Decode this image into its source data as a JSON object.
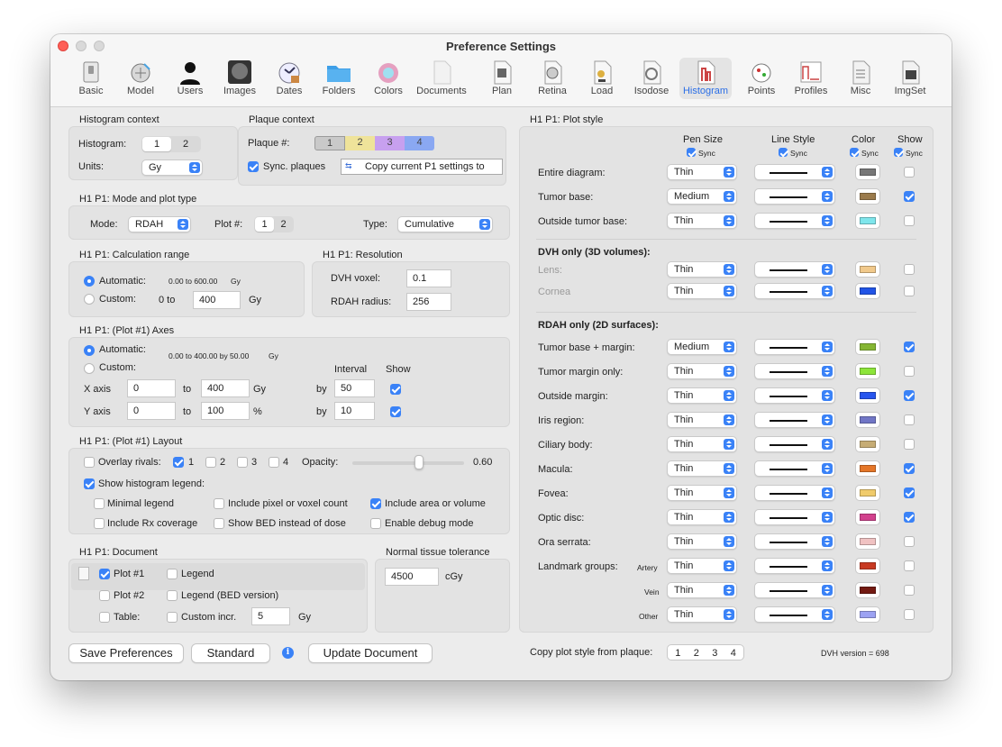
{
  "window": {
    "title": "Preference Settings"
  },
  "toolbar": [
    {
      "label": "Basic"
    },
    {
      "label": "Model"
    },
    {
      "label": "Users"
    },
    {
      "label": "Images"
    },
    {
      "label": "Dates"
    },
    {
      "label": "Folders"
    },
    {
      "label": "Colors"
    },
    {
      "label": "Documents"
    },
    {
      "label": "Plan"
    },
    {
      "label": "Retina"
    },
    {
      "label": "Load"
    },
    {
      "label": "Isodose"
    },
    {
      "label": "Histogram"
    },
    {
      "label": "Points"
    },
    {
      "label": "Profiles"
    },
    {
      "label": "Misc"
    },
    {
      "label": "ImgSet"
    }
  ],
  "histctx": {
    "title": "Histogram context",
    "hist_label": "Histogram:",
    "seg": [
      "1",
      "2"
    ],
    "units_label": "Units:",
    "units_value": "Gy"
  },
  "plaquectx": {
    "title": "Plaque context",
    "label": "Plaque #:",
    "plaques": [
      "1",
      "2",
      "3",
      "4"
    ],
    "sync_label": "Sync. plaques",
    "copy_label": "Copy current P1 settings to"
  },
  "mode": {
    "title": "H1 P1: Mode and plot type",
    "mode_label": "Mode:",
    "mode_value": "RDAH",
    "plot_label": "Plot #:",
    "plot_seg": [
      "1",
      "2"
    ],
    "type_label": "Type:",
    "type_value": "Cumulative"
  },
  "calc": {
    "title": "H1 P1: Calculation range",
    "auto_label": "Automatic:",
    "auto_range": "0.00 to 600.00",
    "auto_unit": "Gy",
    "custom_label": "Custom:",
    "from_text": "0 to",
    "to_value": "400",
    "unit": "Gy"
  },
  "resolution": {
    "title": "H1 P1: Resolution",
    "voxel_label": "DVH voxel:",
    "voxel_value": "0.1",
    "radius_label": "RDAH radius:",
    "radius_value": "256"
  },
  "axes": {
    "title": "H1 P1: (Plot #1) Axes",
    "auto_label": "Automatic:",
    "auto_range": "0.00 to 400.00 by 50.00",
    "auto_unit": "Gy",
    "custom_label": "Custom:",
    "interval_header": "Interval",
    "show_header": "Show",
    "x": {
      "label": "X axis",
      "from": "0",
      "to_text": "to",
      "to": "400",
      "unit": "Gy",
      "by": "by",
      "interval": "50"
    },
    "y": {
      "label": "Y axis",
      "from": "0",
      "to_text": "to",
      "to": "100",
      "unit": "%",
      "by": "by",
      "interval": "10"
    }
  },
  "layout": {
    "title": "H1 P1: (Plot #1) Layout",
    "overlay_label": "Overlay rivals:",
    "rivals": [
      "1",
      "2",
      "3",
      "4"
    ],
    "opacity_label": "Opacity:",
    "opacity_value": "0.60",
    "opacity_fraction": 0.6,
    "show_legend_label": "Show histogram legend:",
    "options": [
      "Minimal legend",
      "Include pixel or voxel count",
      "Include area or volume",
      "Include Rx coverage",
      "Show BED instead of dose",
      "Enable debug mode"
    ]
  },
  "document": {
    "title": "H1 P1: Document",
    "plot1": "Plot #1",
    "plot2": "Plot #2",
    "table": "Table:",
    "legend": "Legend",
    "legend_bed": "Legend (BED version)",
    "custom_incr": "Custom incr.",
    "incr_value": "5",
    "incr_unit": "Gy"
  },
  "ntt": {
    "title": "Normal tissue tolerance",
    "value": "4500",
    "unit": "cGy"
  },
  "buttons": {
    "save": "Save Preferences",
    "standard": "Standard",
    "update": "Update Document"
  },
  "plotstyle": {
    "title": "H1 P1: Plot style",
    "col_pen": "Pen Size",
    "col_line": "Line Style",
    "col_color": "Color",
    "col_show": "Show",
    "sync": "Sync",
    "section_dvh": "DVH only (3D volumes):",
    "section_rdah": "RDAH only (2D surfaces):",
    "landmark_label": "Landmark groups:",
    "rows": [
      {
        "label": "Entire diagram:",
        "pen": "Thin",
        "color": "#777777",
        "show": false
      },
      {
        "label": "Tumor base:",
        "pen": "Medium",
        "color": "#9b7b4c",
        "show": true
      },
      {
        "label": "Outside tumor base:",
        "pen": "Thin",
        "color": "#7fe6ec",
        "show": false
      },
      {
        "label": "Lens:",
        "pen": "Thin",
        "color": "#f1c98b",
        "show": false
      },
      {
        "label": "Cornea",
        "pen": "Thin",
        "color": "#2154e6",
        "show": false
      },
      {
        "label": "Tumor base + margin:",
        "pen": "Medium",
        "color": "#85b633",
        "show": true
      },
      {
        "label": "Tumor margin only:",
        "pen": "Thin",
        "color": "#8de53a",
        "show": false
      },
      {
        "label": "Outside margin:",
        "pen": "Thin",
        "color": "#2755ee",
        "show": true
      },
      {
        "label": "Iris region:",
        "pen": "Thin",
        "color": "#7176c6",
        "show": false
      },
      {
        "label": "Ciliary body:",
        "pen": "Thin",
        "color": "#c6ac74",
        "show": false
      },
      {
        "label": "Macula:",
        "pen": "Thin",
        "color": "#e57628",
        "show": true
      },
      {
        "label": "Fovea:",
        "pen": "Thin",
        "color": "#f0cb6b",
        "show": true
      },
      {
        "label": "Optic disc:",
        "pen": "Thin",
        "color": "#d2418d",
        "show": true
      },
      {
        "label": "Ora serrata:",
        "pen": "Thin",
        "color": "#f0c2c2",
        "show": false
      },
      {
        "label": "Artery",
        "pen": "Thin",
        "color": "#c83a22",
        "show": false
      },
      {
        "label": "Vein",
        "pen": "Thin",
        "color": "#731a12",
        "show": false
      },
      {
        "label": "Other",
        "pen": "Thin",
        "color": "#9ca2f2",
        "show": false
      }
    ]
  },
  "footer": {
    "copy_label": "Copy plot style from plaque:",
    "plaques": [
      "1",
      "2",
      "3",
      "4"
    ],
    "version": "DVH version = 698"
  }
}
